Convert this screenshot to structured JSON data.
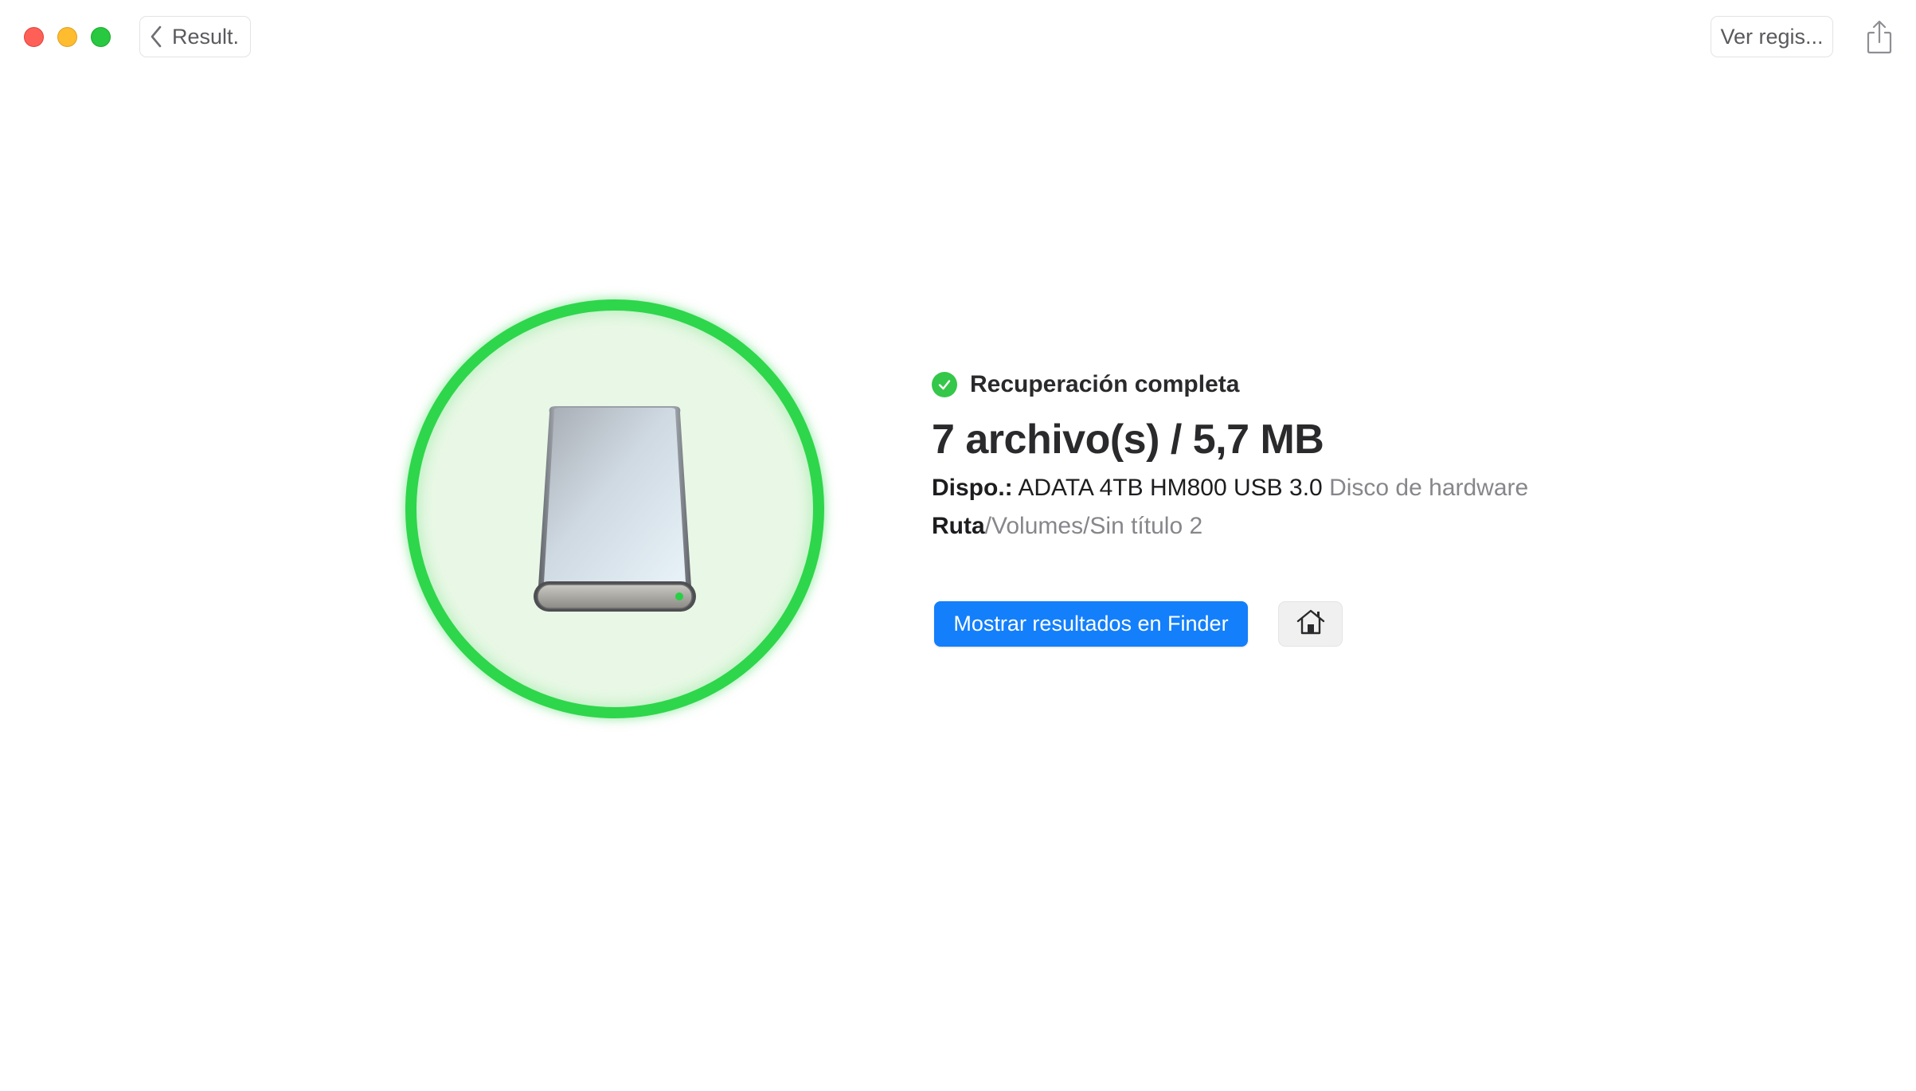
{
  "window": {
    "controls": [
      "close",
      "minimize",
      "maximize"
    ]
  },
  "toolbar": {
    "back_label": "Result.",
    "back_icon": "chevron-left-icon",
    "log_label": "Ver regis...",
    "share_icon": "share-icon"
  },
  "hero": {
    "drive_icon": "external-drive-icon",
    "ring_color": "#2ed64b"
  },
  "result": {
    "status_icon": "checkmark-circle-icon",
    "status": "Recuperación completa",
    "headline": "7 archivo(s) / 5,7 MB",
    "device_label": "Dispo.:",
    "device_name": "ADATA 4TB HM800 USB 3.0",
    "device_type": "Disco de hardware",
    "path_label": "Ruta",
    "path_value": "/Volumes/Sin título 2"
  },
  "actions": {
    "finder_button": "Mostrar resultados en Finder",
    "home_icon": "home-icon",
    "accent": "#137ffb"
  }
}
